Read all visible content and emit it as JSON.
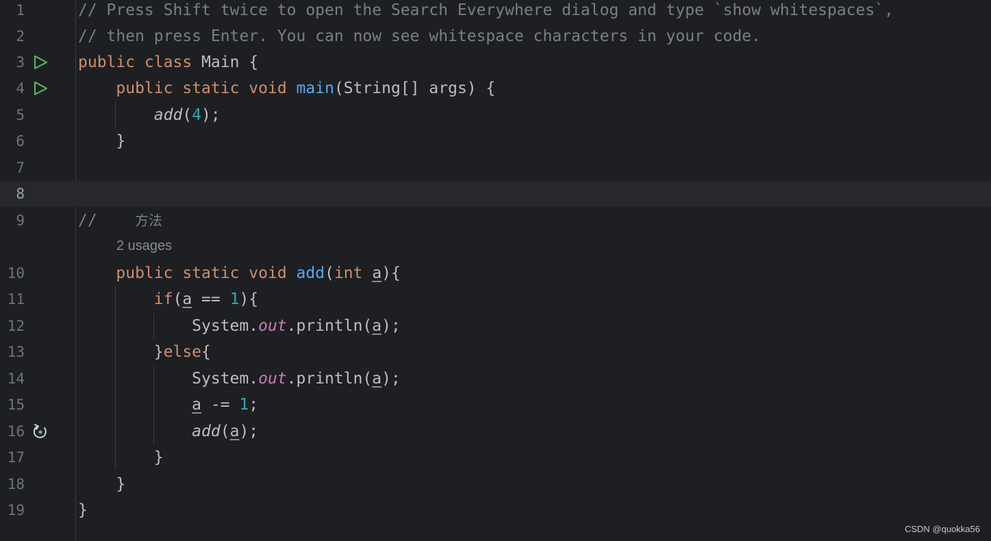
{
  "editor": {
    "line_numbers": [
      "1",
      "2",
      "3",
      "4",
      "5",
      "6",
      "7",
      "8",
      "9",
      "10",
      "11",
      "12",
      "13",
      "14",
      "15",
      "16",
      "17",
      "18",
      "19"
    ],
    "current_line": "8",
    "gutter_icons": {
      "line3": "run-icon",
      "line4": "run-icon",
      "line16": "recursive-call-icon"
    },
    "inlay_hint": "2 usages",
    "code": {
      "l1": "// Press Shift twice to open the Search Everywhere dialog and type `show whitespaces`,",
      "l2": "// then press Enter. You can now see whitespace characters in your code.",
      "l3": {
        "kw1": "public",
        "kw2": "class",
        "name": "Main",
        "brace": "{"
      },
      "l4": {
        "kw1": "public",
        "kw2": "static",
        "kw3": "void",
        "fn": "main",
        "params": "(String[] args)",
        "brace": "{"
      },
      "l5": {
        "call": "add",
        "open": "(",
        "num": "4",
        "close": ");"
      },
      "l6": "}",
      "l9": {
        "comment": "//",
        "label": "方法"
      },
      "l10": {
        "kw1": "public",
        "kw2": "static",
        "kw3": "void",
        "fn": "add",
        "open": "(",
        "type": "int",
        "param": "a",
        "close": "){"
      },
      "l11": {
        "kw": "if",
        "open": "(",
        "param": "a",
        "op": " == ",
        "num": "1",
        "close": "){"
      },
      "l12": {
        "cls": "System.",
        "field": "out",
        "method": ".println(",
        "param": "a",
        "close": ");"
      },
      "l13": {
        "brace": "}",
        "kw": "else",
        "open": "{"
      },
      "l14": {
        "cls": "System.",
        "field": "out",
        "method": ".println(",
        "param": "a",
        "close": ");"
      },
      "l15": {
        "param": "a",
        "op": " -= ",
        "num": "1",
        "semi": ";"
      },
      "l16": {
        "call": "add",
        "open": "(",
        "param": "a",
        "close": ");"
      },
      "l17": "}",
      "l18": "}",
      "l19": "}"
    }
  },
  "colors": {
    "background": "#1e1f22",
    "keyword": "#cf8e6d",
    "function": "#56a8f5",
    "number": "#2aacb8",
    "comment": "#7a7e85",
    "static_field": "#c77dbb",
    "run_icon": "#5fb865"
  },
  "watermark": "CSDN @quokka56"
}
